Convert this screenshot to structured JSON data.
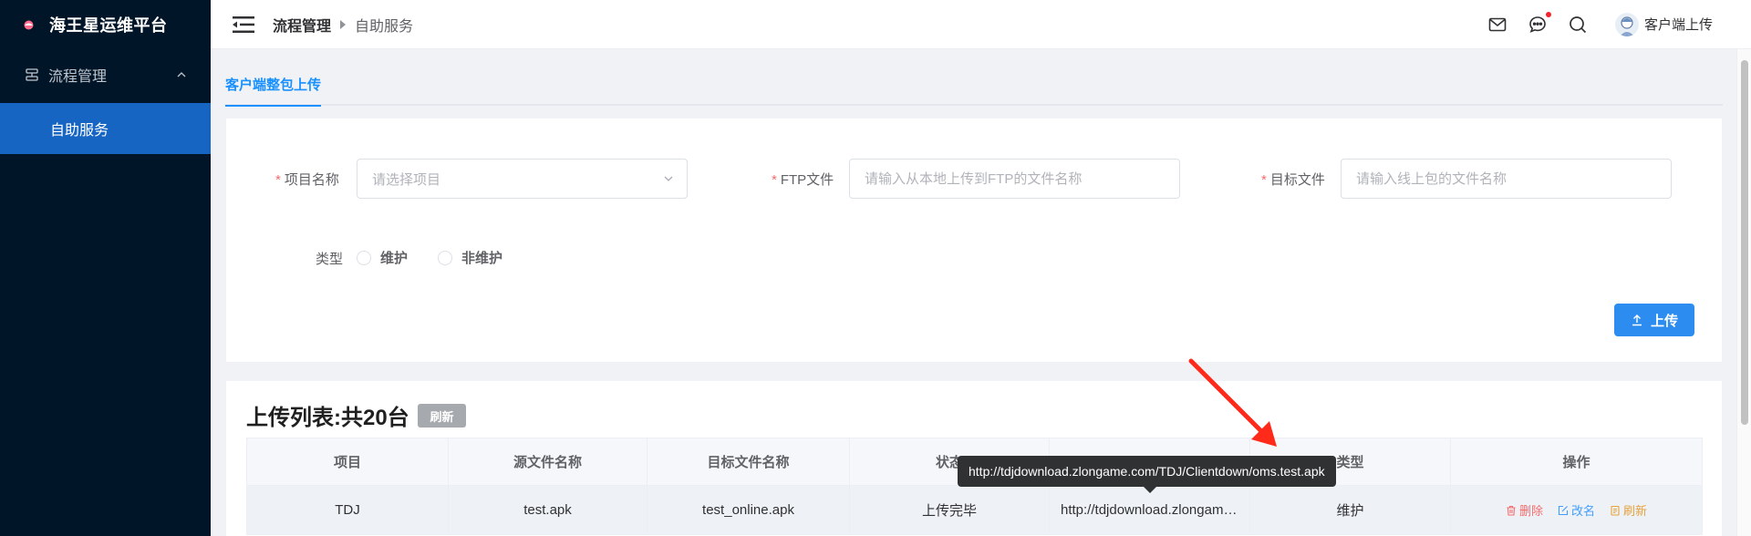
{
  "app": {
    "title": "海王星运维平台"
  },
  "sidebar": {
    "group": {
      "label": "流程管理"
    },
    "items": [
      {
        "label": "自助服务",
        "active": true
      }
    ]
  },
  "header": {
    "breadcrumb": {
      "parent": "流程管理",
      "current": "自助服务"
    },
    "icons": [
      "mail-icon",
      "chat-icon",
      "search-icon"
    ],
    "user": {
      "name": "客户端上传"
    }
  },
  "tab": {
    "label": "客户端整包上传"
  },
  "form": {
    "project": {
      "label": "项目名称",
      "placeholder": "请选择项目",
      "required": true
    },
    "ftp_file": {
      "label": "FTP文件",
      "placeholder": "请输入从本地上传到FTP的文件名称",
      "required": true
    },
    "target_file": {
      "label": "目标文件",
      "placeholder": "请输入线上包的文件名称",
      "required": true
    },
    "type": {
      "label": "类型",
      "options": [
        "维护",
        "非维护"
      ]
    },
    "upload_button": "上传"
  },
  "list": {
    "title": "上传列表:共20台",
    "refresh_tag": "刷新",
    "columns": [
      "项目",
      "源文件名称",
      "目标文件名称",
      "状态",
      "",
      "类型",
      "操作"
    ],
    "rows": [
      {
        "project": "TDJ",
        "source": "test.apk",
        "target": "test_online.apk",
        "status": "上传完毕",
        "url": "http://tdjdownload.zlongame.com/TDJ/Clientdown/oms.test.apk",
        "type": "维护",
        "actions": {
          "delete": "删除",
          "rename": "改名",
          "refresh": "刷新"
        }
      }
    ]
  },
  "tooltip": {
    "text": "http://tdjdownload.zlongame.com/TDJ/Clientdown/oms.test.apk"
  },
  "colors": {
    "primary": "#1890ff",
    "sidebar_bg": "#011529",
    "active_menu": "#1765c2",
    "danger": "#f56c6c",
    "warning": "#e6a23c",
    "annotation": "#ff2a1a"
  }
}
